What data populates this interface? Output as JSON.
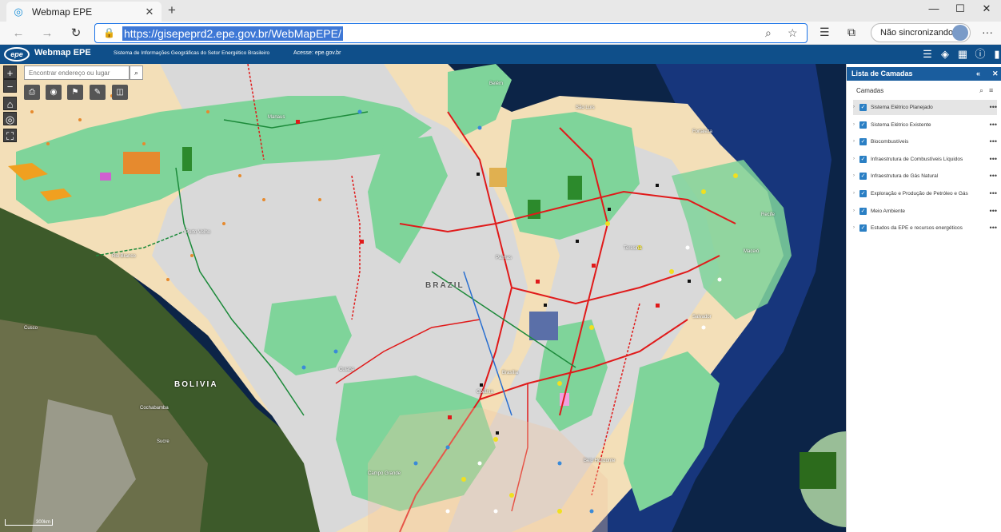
{
  "browser": {
    "tab_title": "Webmap EPE",
    "tab_close": "✕",
    "new_tab": "+",
    "url": "https://gisepeprd2.epe.gov.br/WebMapEPE/",
    "sync_label": "Não sincronizando",
    "window_controls": [
      "—",
      "☐",
      "✕"
    ],
    "more": "···"
  },
  "app": {
    "logo": "epe",
    "title": "Webmap EPE",
    "subtitle": "Sistema de Informações Geográficas do Setor Energético Brasileiro",
    "access": "Acesse: epe.gov.br"
  },
  "map": {
    "search_placeholder": "Encontrar endereço ou lugar",
    "zoom_in": "+",
    "zoom_out": "−",
    "country_labels": {
      "brazil": "BRAZIL",
      "bolivia": "BOLIVIA"
    },
    "city_labels": [
      "Manaus",
      "Porto Velho",
      "Rio Branco",
      "Belém",
      "São Luís",
      "Fortaleza",
      "Recife",
      "Salvador",
      "Palmas",
      "Brasília",
      "Cuiabá",
      "Goiânia",
      "Cusco",
      "Cochabamba",
      "Sucre",
      "Campo Grande",
      "Belo Horizonte",
      "Teresina",
      "Maceió"
    ],
    "scale": "300km"
  },
  "panel": {
    "title": "Lista de Camadas",
    "section": "Camadas",
    "layers": [
      {
        "name": "Sistema Elétrico Planejado",
        "selected": true
      },
      {
        "name": "Sistema Elétrico Existente",
        "selected": false
      },
      {
        "name": "Biocombustíveis",
        "selected": false
      },
      {
        "name": "Infraestrutura de Combustíveis Líquidos",
        "selected": false
      },
      {
        "name": "Infraestrutura de Gás Natural",
        "selected": false
      },
      {
        "name": "Exploração e Produção de Petróleo e Gás",
        "selected": false
      },
      {
        "name": "Meio Ambiente",
        "selected": false
      },
      {
        "name": "Estudos da EPE e recursos energéticos",
        "selected": false
      }
    ]
  },
  "colors": {
    "header": "#0f4f8a",
    "panel_header": "#1a5d9e",
    "protected_area": "#7fd49a",
    "land_gray": "#d9d9d9",
    "transmission_line": "#e01a1a",
    "ocean": "#0c2447"
  }
}
